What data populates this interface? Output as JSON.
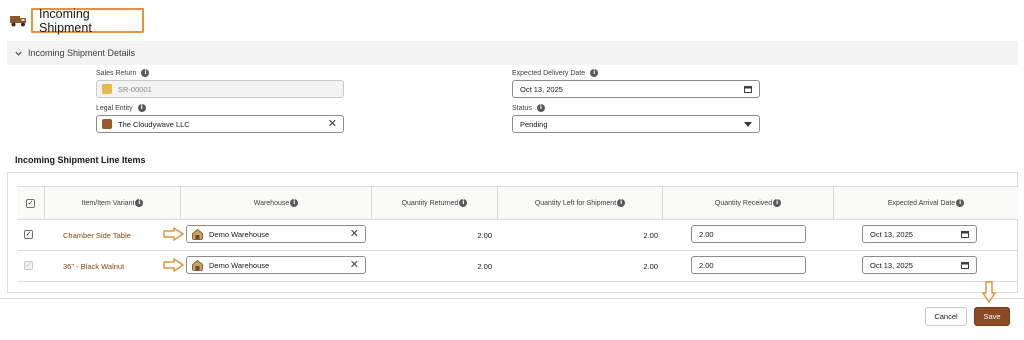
{
  "header": {
    "title": "Incoming Shipment",
    "icon": "truck-icon"
  },
  "section": {
    "title": "Incoming Shipment Details"
  },
  "fields": {
    "sales_return": {
      "label": "Sales Return",
      "value": "SR-00001"
    },
    "legal_entity": {
      "label": "Legal Entity",
      "value": "The Cloudywave LLC"
    },
    "expected_delivery_date": {
      "label": "Expected Delivery Date",
      "value": "Oct 13, 2025"
    },
    "status": {
      "label": "Status",
      "value": "Pending"
    }
  },
  "line_items": {
    "title": "Incoming Shipment Line Items",
    "columns": [
      "Item/Item Variant",
      "Warehouse",
      "Quantity Returned",
      "Quantity Left for Shipment",
      "Quantity Received",
      "Expected Arrival Date"
    ],
    "rows": [
      {
        "item": "Chamber Side Table",
        "warehouse": "Demo Warehouse",
        "qty_returned": "2.00",
        "qty_left": "2.00",
        "qty_received": "2.00",
        "arrival_date": "Oct 13, 2025"
      },
      {
        "item": "36\" - Black Walnut",
        "warehouse": "Demo Warehouse",
        "qty_returned": "2.00",
        "qty_left": "2.00",
        "qty_received": "2.00",
        "arrival_date": "Oct 13, 2025"
      }
    ]
  },
  "buttons": {
    "cancel": "Cancel",
    "save": "Save"
  },
  "colors": {
    "accent": "#8b4a24",
    "highlight": "#e0953d",
    "link": "#8b4513"
  }
}
